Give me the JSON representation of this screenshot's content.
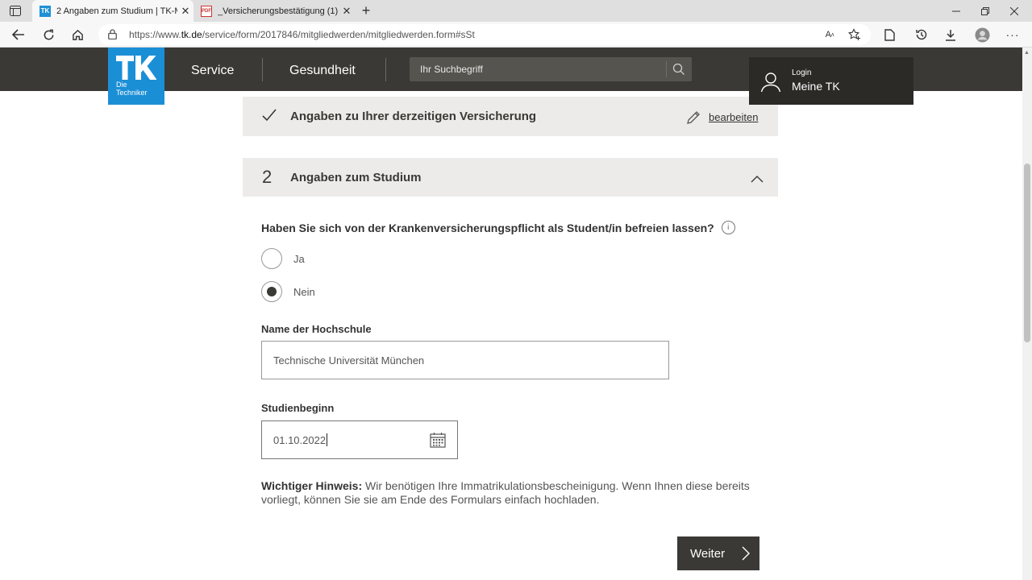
{
  "browser": {
    "tabs": [
      {
        "title": "2 Angaben zum Studium | TK-Mi",
        "favicon": "tk-favicon",
        "active": true
      },
      {
        "title": "_Versicherungsbestätigung (1).PD",
        "favicon": "pdf-favicon",
        "active": false
      }
    ],
    "url_prefix": "https://www.",
    "url_domain": "tk.de",
    "url_path": "/service/form/2017846/mitgliedwerden/mitgliedwerden.form#sSt"
  },
  "header": {
    "logo_line1": "Die",
    "logo_line2": "Techniker",
    "nav": [
      "Service",
      "Gesundheit"
    ],
    "search_placeholder": "Ihr Suchbegriff",
    "login_small": "Login",
    "login_main": "Meine TK"
  },
  "sections": {
    "current_insurance": {
      "title": "Angaben zu Ihrer derzeitigen Versicherung",
      "edit_label": "bearbeiten"
    },
    "study": {
      "number": "2",
      "title": "Angaben zum Studium"
    }
  },
  "form": {
    "question": "Haben Sie sich von der Krankenversicherungspflicht als Student/in befreien lassen?",
    "info_glyph": "i",
    "options": [
      {
        "label": "Ja",
        "checked": false
      },
      {
        "label": "Nein",
        "checked": true
      }
    ],
    "university_label": "Name der Hochschule",
    "university_value": "Technische Universität München",
    "start_label": "Studienbeginn",
    "start_value": "01.10.2022"
  },
  "hint": {
    "bold": "Wichtiger Hinweis:",
    "text": " Wir benötigen Ihre Immatrikulationsbescheinigung. Wenn Ihnen diese bereits vorliegt, können Sie sie am Ende des Formulars einfach hochladen."
  },
  "actions": {
    "next_label": "Weiter"
  }
}
